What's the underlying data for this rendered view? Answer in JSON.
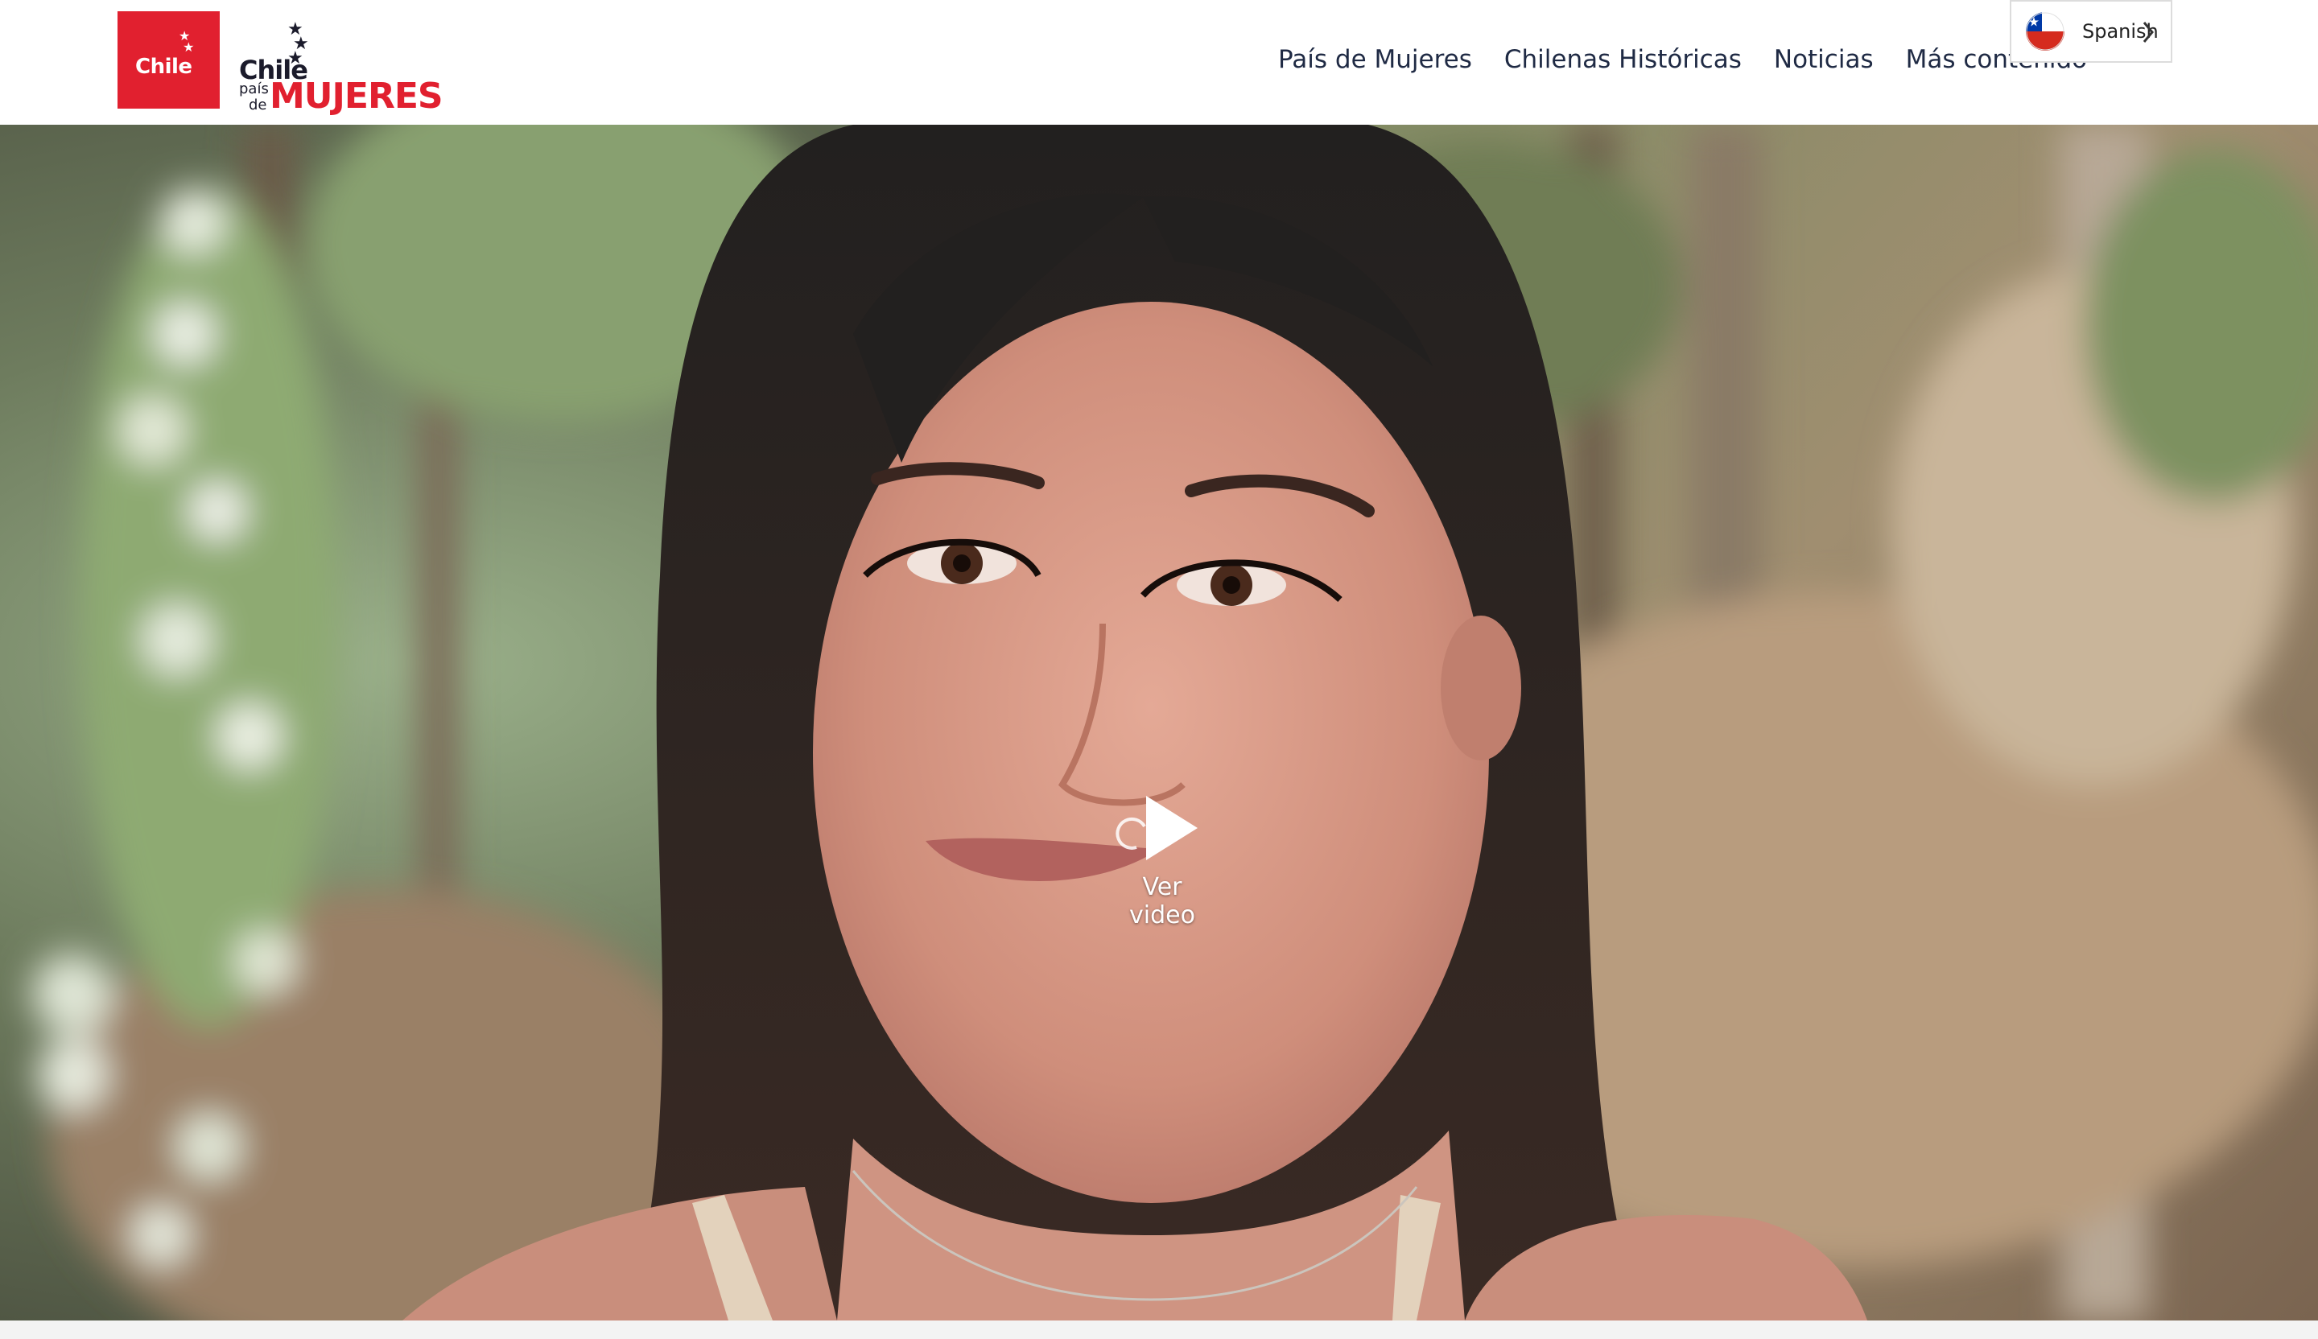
{
  "header": {
    "logo_chile_text": "Chile",
    "logo_pais": {
      "chile": "Chile",
      "pais": "país",
      "de": "de",
      "mujeres": "MUJERES"
    },
    "nav": [
      {
        "label": "País de Mujeres"
      },
      {
        "label": "Chilenas Históricas"
      },
      {
        "label": "Noticias"
      },
      {
        "label": "Más contenido"
      }
    ]
  },
  "language_selector": {
    "label": "Spanish",
    "flag_icon": "chile-flag-icon",
    "chevron_icon": "chevron-right-icon"
  },
  "hero": {
    "play_label": "Ver video",
    "play_icon": "play-icon"
  },
  "colors": {
    "brand_red": "#e1202f",
    "nav_text": "#1f2a44"
  }
}
